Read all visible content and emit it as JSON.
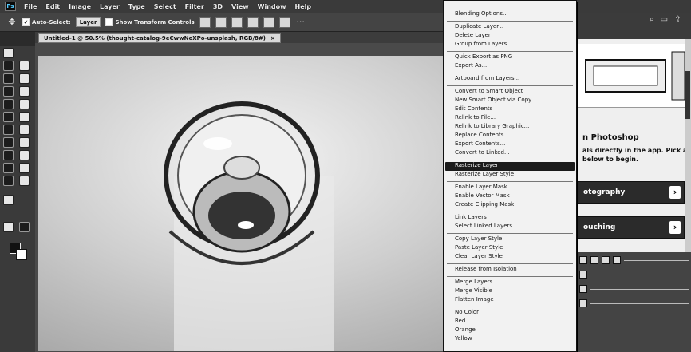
{
  "menubar": {
    "logo": "Ps",
    "items": [
      "File",
      "Edit",
      "Image",
      "Layer",
      "Type",
      "Select",
      "Filter",
      "3D",
      "View",
      "Window",
      "Help"
    ]
  },
  "options": {
    "auto_select_label": "Auto-Select:",
    "auto_select_checked": true,
    "auto_select_target": "Layer",
    "transform_controls_label": "Show Transform Controls",
    "transform_controls_checked": false
  },
  "document_tab": {
    "title": "Untitled-1 @ 50.5% (thought-catalog-9eCwwNeXPo-unsplash, RGB/8#)",
    "close": "×"
  },
  "context_menu": {
    "groups": [
      [
        {
          "label": "Blending Options..."
        }
      ],
      [
        {
          "label": "Duplicate Layer..."
        },
        {
          "label": "Delete Layer"
        },
        {
          "label": "Group from Layers..."
        }
      ],
      [
        {
          "label": "Quick Export as PNG"
        },
        {
          "label": "Export As..."
        }
      ],
      [
        {
          "label": "Artboard from Layers..."
        }
      ],
      [
        {
          "label": "Convert to Smart Object"
        },
        {
          "label": "New Smart Object via Copy"
        },
        {
          "label": "Edit Contents"
        },
        {
          "label": "Relink to File..."
        },
        {
          "label": "Relink to Library Graphic..."
        },
        {
          "label": "Replace Contents..."
        },
        {
          "label": "Export Contents..."
        },
        {
          "label": "Convert to Linked..."
        }
      ],
      [
        {
          "label": "Rasterize Layer",
          "highlighted": true
        },
        {
          "label": "Rasterize Layer Style"
        }
      ],
      [
        {
          "label": "Enable Layer Mask"
        },
        {
          "label": "Enable Vector Mask"
        },
        {
          "label": "Create Clipping Mask"
        }
      ],
      [
        {
          "label": "Link Layers"
        },
        {
          "label": "Select Linked Layers"
        }
      ],
      [
        {
          "label": "Copy Layer Style"
        },
        {
          "label": "Paste Layer Style"
        },
        {
          "label": "Clear Layer Style"
        }
      ],
      [
        {
          "label": "Release from Isolation"
        }
      ],
      [
        {
          "label": "Merge Layers"
        },
        {
          "label": "Merge Visible"
        },
        {
          "label": "Flatten Image"
        }
      ],
      [
        {
          "label": "No Color"
        },
        {
          "label": "Red"
        },
        {
          "label": "Orange"
        },
        {
          "label": "Yellow"
        }
      ]
    ]
  },
  "learn_panel": {
    "title": "n Photoshop",
    "description": "als directly in the app. Pick a below to begin.",
    "cards": [
      "otography",
      "ouching"
    ],
    "chevron": "›"
  },
  "icons": {
    "move_tool": "move-icon",
    "gear": "gear-icon"
  },
  "colors": {
    "highlight": "#1b1b1b",
    "menu_bg": "#f2f2f2",
    "chrome": "#3a3a3a"
  }
}
